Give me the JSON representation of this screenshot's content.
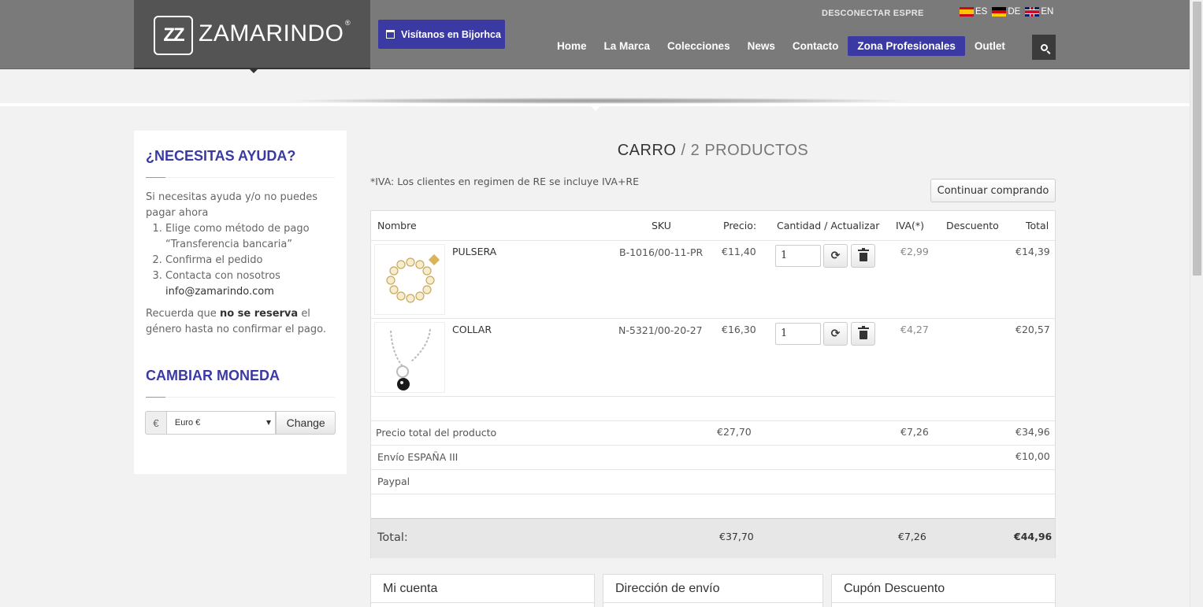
{
  "header": {
    "logo_mark": "ZZ",
    "logo_text": "ZAMARINDO",
    "logo_reg": "®",
    "visit_label": "Visítanos en Bijorhca",
    "disconnect_label": "DESCONECTAR ESPRE",
    "languages": [
      {
        "code": "ES",
        "flag": "flag-es"
      },
      {
        "code": "DE",
        "flag": "flag-de"
      },
      {
        "code": "EN",
        "flag": "flag-en"
      }
    ],
    "nav": [
      "Home",
      "La Marca",
      "Colecciones",
      "News",
      "Contacto",
      "Zona Profesionales",
      "Outlet"
    ],
    "nav_active": "Zona Profesionales",
    "accent_color": "#3b3aa3"
  },
  "sidebar": {
    "help_title": "¿NECESITAS AYUDA?",
    "help_intro": "Si necesitas ayuda y/o no puedes pagar ahora",
    "help_steps": [
      "Elige como método de pago “Transferencia bancaria”",
      "Confirma el pedido",
      "Contacta con nosotros"
    ],
    "help_email": "info@zamarindo.com",
    "reserve_pre": "Recuerda que",
    "reserve_bold": "no se reserva",
    "reserve_post": "el género hasta no confirmar el pago.",
    "currency_title": "CAMBIAR MONEDA",
    "currency_symbol": "€",
    "currency_selected": "Euro €",
    "currency_button": "Change"
  },
  "cart": {
    "title": "CARRO",
    "subtitle": "2 PRODUCTOS",
    "iva_note": "*IVA: Los clientes en regimen de RE se incluye IVA+RE",
    "continue_label": "Continuar comprando",
    "columns": [
      "Nombre",
      "SKU",
      "Precio:",
      "Cantidad / Actualizar",
      "IVA(*)",
      "Descuento",
      "Total"
    ],
    "items": [
      {
        "name": "PULSERA",
        "sku": "B-1016/00-11-PR",
        "price": "€11,40",
        "qty": "1",
        "iva": "€2,99",
        "discount": "",
        "total": "€14,39"
      },
      {
        "name": "COLLAR",
        "sku": "N-5321/00-20-27",
        "price": "€16,30",
        "qty": "1",
        "iva": "€4,27",
        "discount": "",
        "total": "€20,57"
      }
    ],
    "product_total": {
      "label": "Precio total del producto",
      "price": "€27,70",
      "iva": "€7,26",
      "total": "€34,96"
    },
    "shipping": {
      "label": "Envío ESPAÑA III",
      "total": "€10,00"
    },
    "payment": {
      "label": "Paypal"
    },
    "grand_total": {
      "label": "Total:",
      "price": "€37,70",
      "iva": "€7,26",
      "total": "€44,96"
    }
  },
  "panels": [
    "Mi cuenta",
    "Dirección de envío",
    "Cupón Descuento"
  ]
}
